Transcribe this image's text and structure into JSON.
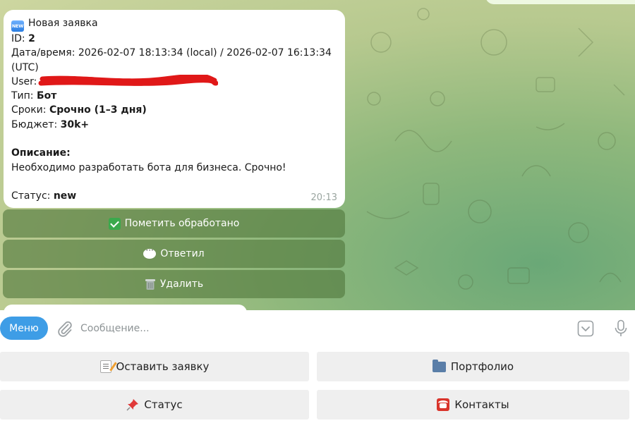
{
  "message": {
    "title_badge": "NEW",
    "title": "Новая заявка",
    "id_label": "ID:",
    "id_value": "2",
    "datetime_label": "Дата/время:",
    "datetime_value": "2026-02-07 18:13:34 (local) / 2026-02-07 16:13:34",
    "datetime_tz": "(UTC)",
    "user_label": "User:",
    "type_label": "Тип:",
    "type_value": "Бот",
    "terms_label": "Сроки:",
    "terms_value": "Срочно (1–3 дня)",
    "budget_label": "Бюджет:",
    "budget_value": "30k+",
    "description_label": "Описание:",
    "description_value": "Необходимо разработать бота для бизнеса. Срочно!",
    "status_label": "Статус:",
    "status_value": "new",
    "time": "20:13"
  },
  "inline_buttons": [
    {
      "label": "Пометить обработано",
      "icon": "check-mark-icon"
    },
    {
      "label": "Ответил",
      "icon": "speech-bubble-icon"
    },
    {
      "label": "Удалить",
      "icon": "trash-can-icon"
    }
  ],
  "input_bar": {
    "menu_label": "Меню",
    "placeholder": "Сообщение..."
  },
  "keyboard": [
    {
      "label": "Оставить заявку",
      "icon": "memo-icon"
    },
    {
      "label": "Портфолио",
      "icon": "folder-icon"
    },
    {
      "label": "Статус",
      "icon": "pushpin-icon"
    },
    {
      "label": "Контакты",
      "icon": "telephone-icon"
    }
  ],
  "colors": {
    "menu_button": "#3e9de6",
    "inline_button": "#5a8448",
    "keyboard_button": "#efefef",
    "bubble": "#ffffff"
  }
}
